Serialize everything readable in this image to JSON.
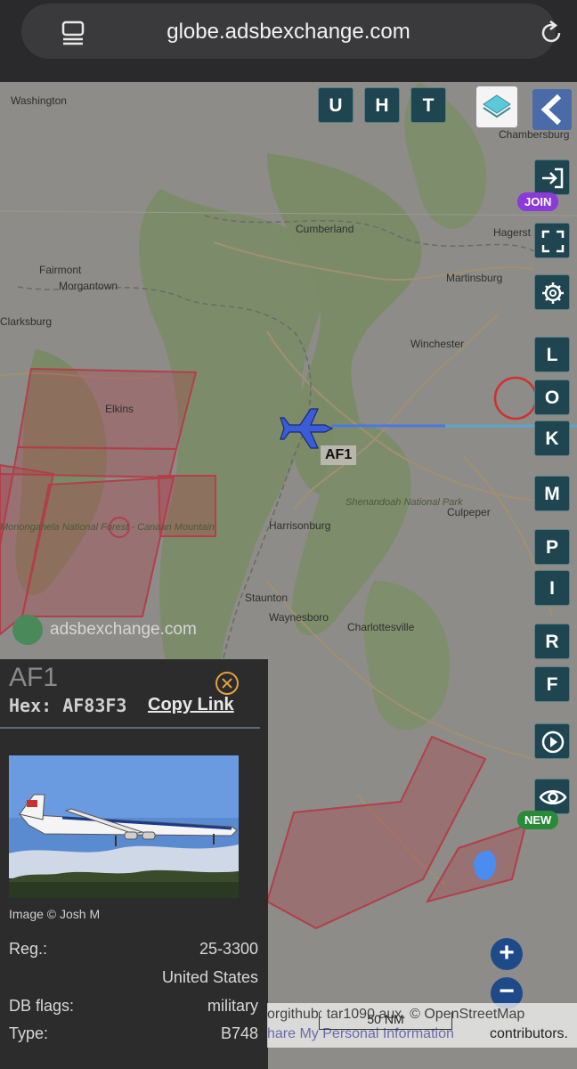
{
  "browser": {
    "url": "globe.adsbexchange.com"
  },
  "map": {
    "places": [
      {
        "name": "Washington"
      },
      {
        "name": "Chambersburg"
      },
      {
        "name": "Cumberland"
      },
      {
        "name": "Morgantown"
      },
      {
        "name": "Hagerst"
      },
      {
        "name": "Fairmont"
      },
      {
        "name": "Martinsburg"
      },
      {
        "name": "Clarksburg"
      },
      {
        "name": "Winchester"
      },
      {
        "name": "Elkins"
      },
      {
        "name": "Culpeper"
      },
      {
        "name": "Harrisonburg"
      },
      {
        "name": "Staunton"
      },
      {
        "name": "Waynesboro"
      },
      {
        "name": "Charlottesville"
      }
    ],
    "parks": {
      "shenandoah": "Shenandoah National Park",
      "monongahela": "Monongahela National Forest - Canaan Mountain"
    },
    "aircraft_label": "AF1",
    "watermark": "adsbexchange.com"
  },
  "top_buttons": {
    "u": "U",
    "h": "H",
    "t": "T"
  },
  "side_buttons": {
    "join_badge": "JOIN",
    "l": "L",
    "o": "O",
    "k": "K",
    "m": "M",
    "p": "P",
    "i": "I",
    "r": "R",
    "f": "F",
    "new_badge": "NEW"
  },
  "info_panel": {
    "callsign": "AF1",
    "hex_label": "Hex:",
    "hex_value": "AF83F3",
    "copy_link": "Copy Link",
    "image_credit": "Image © Josh M",
    "rows": [
      {
        "key": "Reg.:",
        "value": "25-3300"
      },
      {
        "key": "",
        "value": "United States"
      },
      {
        "key": "DB flags:",
        "value": "military"
      },
      {
        "key": "Type:",
        "value": "B748"
      }
    ]
  },
  "zoom": {
    "in": "+",
    "out": "−"
  },
  "attribution": {
    "line1": "orgithub: tar1090 aux. © OpenStreetMap",
    "line2": "hare My Personal Information",
    "contributors": "contributors.",
    "scale": "50 NM"
  },
  "colors": {
    "restricted_area": "#b0404a",
    "track": "#4a78e0",
    "aircraft": "#3a5cd8",
    "button_bg": "#1f4650"
  }
}
